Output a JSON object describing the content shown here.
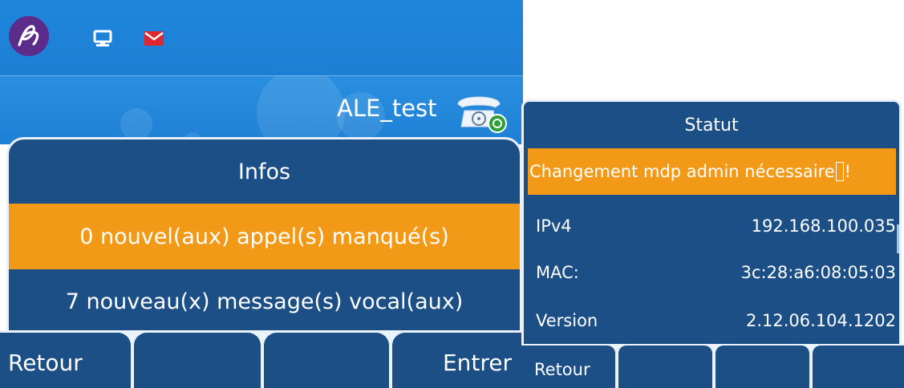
{
  "left_screen": {
    "user_name": "ALE_test",
    "panel": {
      "title": "Infos",
      "items": [
        {
          "label": "0 nouvel(aux) appel(s) manqué(s)",
          "selected": true
        },
        {
          "label": "7 nouveau(x) message(s) vocal(aux)",
          "selected": false
        }
      ]
    },
    "softkeys": [
      "Retour",
      "",
      "",
      "Entrer"
    ],
    "icons": [
      "alcatel-logo-icon",
      "computer-icon",
      "mail-icon",
      "desk-phone-icon",
      "online-status-icon"
    ]
  },
  "right_screen": {
    "title": "Statut",
    "alert": {
      "text": "Changement mdp admin nécessaire",
      "suffix": "!"
    },
    "rows": [
      {
        "key": "IPv4",
        "value": "192.168.100.035"
      },
      {
        "key": "MAC:",
        "value": "3c:28:a6:08:05:03"
      },
      {
        "key": "Version",
        "value": "2.12.06.104.1202"
      }
    ],
    "softkeys": [
      "Retour",
      "",
      "",
      ""
    ]
  },
  "colors": {
    "header_blue": "#1f86dc",
    "panel_navy": "#1b4f86",
    "highlight_orange": "#f29a17",
    "mail_red": "#e0262f",
    "logo_purple": "#5b2c8a",
    "status_green": "#2e9e3c"
  }
}
